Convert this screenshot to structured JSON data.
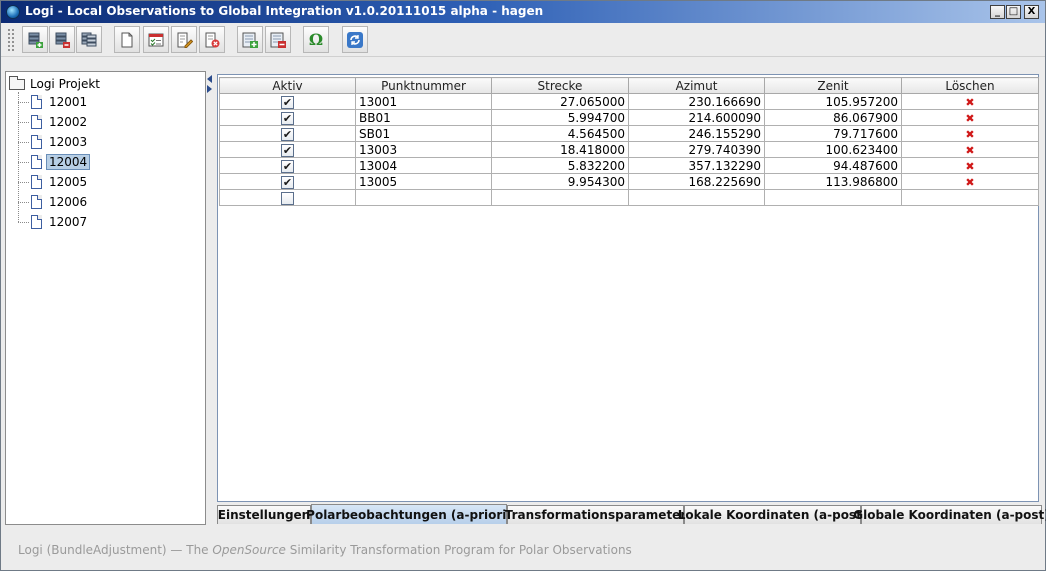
{
  "window": {
    "title": "Logi - Local Observations to Global Integration v1.0.20111015 alpha - hagen",
    "controls": {
      "minimize": "_",
      "maximize": "□",
      "close": "X"
    }
  },
  "toolbar": {
    "buttons": [
      {
        "icon": "database-add-icon"
      },
      {
        "icon": "database-remove-icon"
      },
      {
        "icon": "database-stack-icon"
      },
      {
        "icon": "new-document-icon"
      },
      {
        "icon": "checklist-document-icon"
      },
      {
        "icon": "edit-document-icon"
      },
      {
        "icon": "delete-document-icon"
      },
      {
        "icon": "import-add-icon"
      },
      {
        "icon": "import-remove-icon"
      },
      {
        "icon": "omega-icon",
        "glyph": "Ω"
      },
      {
        "icon": "refresh-icon"
      }
    ]
  },
  "tree": {
    "root": "Logi Projekt",
    "items": [
      "12001",
      "12002",
      "12003",
      "12004",
      "12005",
      "12006",
      "12007"
    ],
    "selected": "12004"
  },
  "table": {
    "columns": [
      "Aktiv",
      "Punktnummer",
      "Strecke",
      "Azimut",
      "Zenit",
      "Löschen"
    ],
    "rows": [
      {
        "aktiv": true,
        "punktnummer": "13001",
        "strecke": "27.065000",
        "azimut": "230.166690",
        "zenit": "105.957200"
      },
      {
        "aktiv": true,
        "punktnummer": "BB01",
        "strecke": "5.994700",
        "azimut": "214.600090",
        "zenit": "86.067900"
      },
      {
        "aktiv": true,
        "punktnummer": "SB01",
        "strecke": "4.564500",
        "azimut": "246.155290",
        "zenit": "79.717600"
      },
      {
        "aktiv": true,
        "punktnummer": "13003",
        "strecke": "18.418000",
        "azimut": "279.740390",
        "zenit": "100.623400"
      },
      {
        "aktiv": true,
        "punktnummer": "13004",
        "strecke": "5.832200",
        "azimut": "357.132290",
        "zenit": "94.487600"
      },
      {
        "aktiv": true,
        "punktnummer": "13005",
        "strecke": "9.954300",
        "azimut": "168.225690",
        "zenit": "113.986800"
      }
    ],
    "checkmark": "✔",
    "delete_glyph": "✖"
  },
  "tabs": [
    {
      "label": "Einstellungen",
      "active": false
    },
    {
      "label": "Polarbeobachtungen (a-priori)",
      "active": true
    },
    {
      "label": "Transformationsparameter",
      "active": false
    },
    {
      "label": "Lokale Koordinaten (a-post)",
      "active": false
    },
    {
      "label": "Globale Koordinaten (a-post)",
      "active": false
    }
  ],
  "status": {
    "prefix": "Logi (BundleAdjustment) — The ",
    "italic": "OpenSource",
    "suffix": " Similarity Transformation Program for Polar Observations"
  }
}
